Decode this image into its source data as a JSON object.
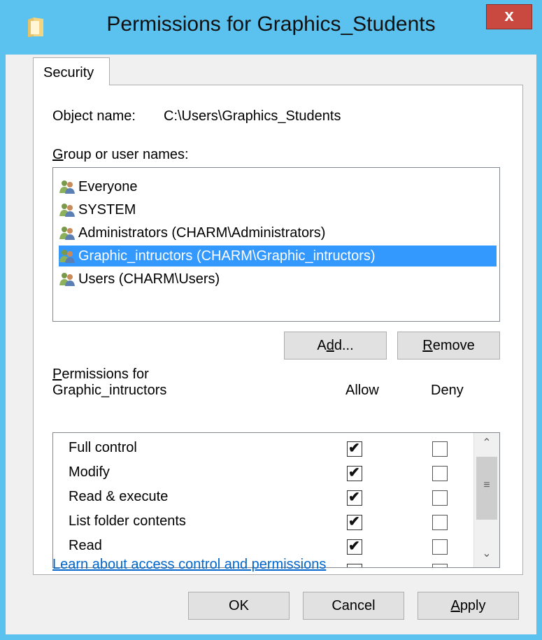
{
  "window": {
    "title": "Permissions for Graphics_Students",
    "close_glyph": "x"
  },
  "tab": {
    "label": "Security"
  },
  "object": {
    "label": "Object name:",
    "value": "C:\\Users\\Graphics_Students"
  },
  "groups": {
    "label": "Group or user names:",
    "label_underline": "G",
    "label_rest": "roup or user names:",
    "items": [
      {
        "label": "Everyone",
        "selected": false
      },
      {
        "label": "SYSTEM",
        "selected": false
      },
      {
        "label": "Administrators (CHARM\\Administrators)",
        "selected": false
      },
      {
        "label": "Graphic_intructors (CHARM\\Graphic_intructors)",
        "selected": true
      },
      {
        "label": "Users (CHARM\\Users)",
        "selected": false
      }
    ]
  },
  "buttons": {
    "add_pre": "A",
    "add_u": "d",
    "add_post": "d...",
    "remove_u": "R",
    "remove_post": "emove",
    "ok": "OK",
    "cancel": "Cancel",
    "apply_u": "A",
    "apply_post": "pply"
  },
  "permissions": {
    "label_u": "P",
    "label_line1_rest": "ermissions for",
    "label_line2": "Graphic_intructors",
    "allow_header": "Allow",
    "deny_header": "Deny",
    "rows": [
      {
        "label": "Full control",
        "allow": true,
        "deny": false
      },
      {
        "label": "Modify",
        "allow": true,
        "deny": false
      },
      {
        "label": "Read & execute",
        "allow": true,
        "deny": false
      },
      {
        "label": "List folder contents",
        "allow": true,
        "deny": false
      },
      {
        "label": "Read",
        "allow": true,
        "deny": false
      }
    ],
    "check_glyph": "✔"
  },
  "scrollbar": {
    "up": "⌃",
    "down": "⌄",
    "grip": "≡"
  },
  "link": {
    "text": "Learn about access control and permissions"
  },
  "colors": {
    "title_bar": "#5bc2ef",
    "close": "#c9483f",
    "selection": "#3399ff",
    "link": "#0066cc"
  }
}
